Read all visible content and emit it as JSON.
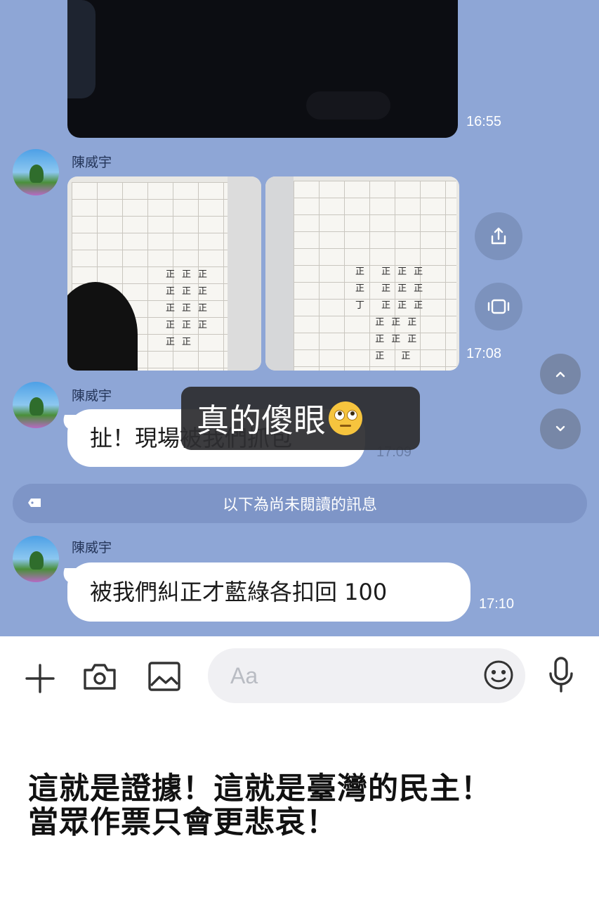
{
  "chat": {
    "top_video": {
      "time": "16:55"
    },
    "photo_message": {
      "sender": "陳威宇",
      "time": "17:08"
    },
    "message_1": {
      "sender": "陳威宇",
      "text": "扯！現場被我們抓包",
      "time": "17:09"
    },
    "unread_divider": {
      "label": "以下為尚未閱讀的訊息"
    },
    "message_2": {
      "sender": "陳威宇",
      "text": "被我們糾正才藍綠各扣回 100",
      "time": "17:10"
    },
    "overlay_caption": "真的傻眼"
  },
  "input_bar": {
    "placeholder": "Aa",
    "icons": [
      "plus-icon",
      "camera-icon",
      "image-icon",
      "emoji-icon",
      "microphone-icon"
    ]
  },
  "side_actions": [
    "share-icon",
    "screenshot-icon",
    "scroll-up-icon",
    "scroll-down-icon"
  ],
  "footer_caption": {
    "line1": "這就是證據！這就是臺灣的民主！",
    "line2": "當眾作票只會更悲哀！"
  },
  "colors": {
    "chat_background": "#8ea6d6",
    "bubble": "#ffffff",
    "unread_bar": "#7d94c6",
    "overlay": "#2d2d30"
  }
}
